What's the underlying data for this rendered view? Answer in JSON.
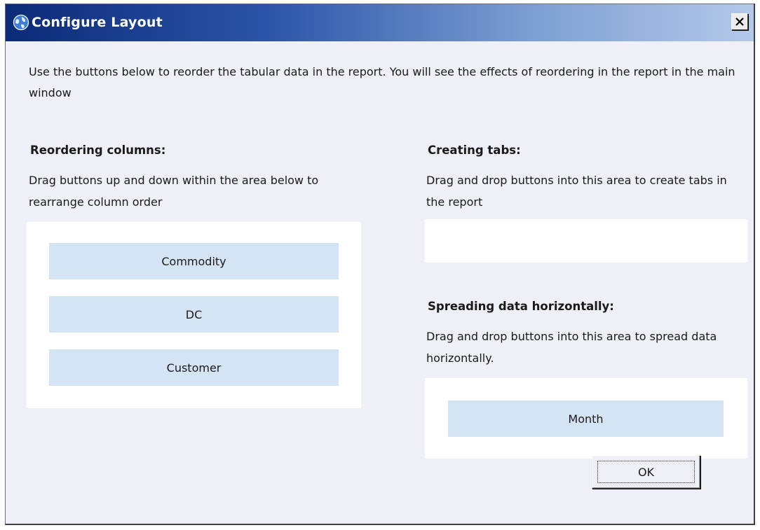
{
  "window": {
    "title": "Configure Layout",
    "close_label": "X"
  },
  "intro_text": "Use the buttons below to reorder the tabular data in the report. You will see the effects of reordering in the report in the main window",
  "reorder": {
    "heading": "Reordering columns:",
    "description": "Drag buttons up and down within the area below to rearrange column order",
    "items": [
      "Commodity",
      "DC",
      "Customer"
    ]
  },
  "tabs": {
    "heading": "Creating tabs:",
    "description": "Drag and drop buttons into this area to create tabs in the report",
    "items": []
  },
  "spread": {
    "heading": "Spreading data horizontally:",
    "description": "Drag and drop buttons into this area to spread data horizontally.",
    "items": [
      "Month"
    ]
  },
  "ok_label": "OK",
  "colors": {
    "title_gradient_start": "#0b2a78",
    "title_gradient_end": "#b4c9e9",
    "dialog_background": "#eeeff7",
    "drag_button": "#d4e4f5"
  },
  "icons": {
    "title": "globe-icon",
    "close": "close-icon"
  }
}
